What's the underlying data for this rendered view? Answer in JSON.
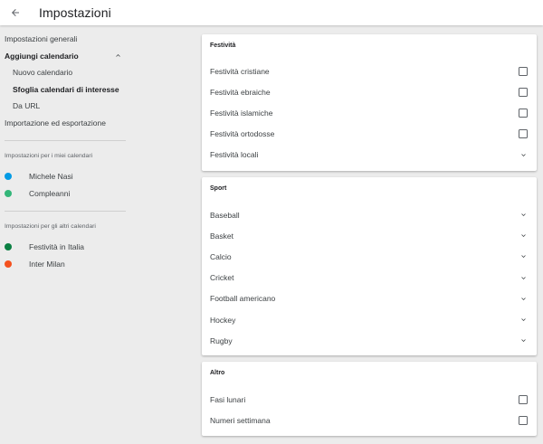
{
  "header": {
    "title": "Impostazioni",
    "back_icon": "arrow-left-icon"
  },
  "sidebar": {
    "items": [
      {
        "label": "Impostazioni generali"
      },
      {
        "label": "Aggiungi calendario",
        "expanded": true
      },
      {
        "label": "Nuovo calendario"
      },
      {
        "label": "Sfoglia calendari di interesse",
        "selected": true
      },
      {
        "label": "Da URL"
      },
      {
        "label": "Importazione ed esportazione"
      }
    ],
    "my_calendars": {
      "heading": "Impostazioni per i miei calendari",
      "items": [
        {
          "label": "Michele Nasi",
          "color": "#039be5"
        },
        {
          "label": "Compleanni",
          "color": "#33b679"
        }
      ]
    },
    "other_calendars": {
      "heading": "Impostazioni per gli altri calendari",
      "items": [
        {
          "label": "Festività in Italia",
          "color": "#0b8043"
        },
        {
          "label": "Inter Milan",
          "color": "#f4511e"
        }
      ]
    }
  },
  "main": {
    "festivita": {
      "title": "Festività",
      "rows": [
        {
          "label": "Festività cristiane",
          "control": "checkbox",
          "checked": false
        },
        {
          "label": "Festività ebraiche",
          "control": "checkbox",
          "checked": false
        },
        {
          "label": "Festività islamiche",
          "control": "checkbox",
          "checked": false
        },
        {
          "label": "Festività ortodosse",
          "control": "checkbox",
          "checked": false
        },
        {
          "label": "Festività locali",
          "control": "expand"
        }
      ]
    },
    "sport": {
      "title": "Sport",
      "rows": [
        {
          "label": "Baseball",
          "control": "expand"
        },
        {
          "label": "Basket",
          "control": "expand"
        },
        {
          "label": "Calcio",
          "control": "expand"
        },
        {
          "label": "Cricket",
          "control": "expand"
        },
        {
          "label": "Football americano",
          "control": "expand"
        },
        {
          "label": "Hockey",
          "control": "expand"
        },
        {
          "label": "Rugby",
          "control": "expand"
        }
      ]
    },
    "altro": {
      "title": "Altro",
      "rows": [
        {
          "label": "Fasi lunari",
          "control": "checkbox",
          "checked": false
        },
        {
          "label": "Numeri settimana",
          "control": "checkbox",
          "checked": false
        }
      ]
    }
  }
}
